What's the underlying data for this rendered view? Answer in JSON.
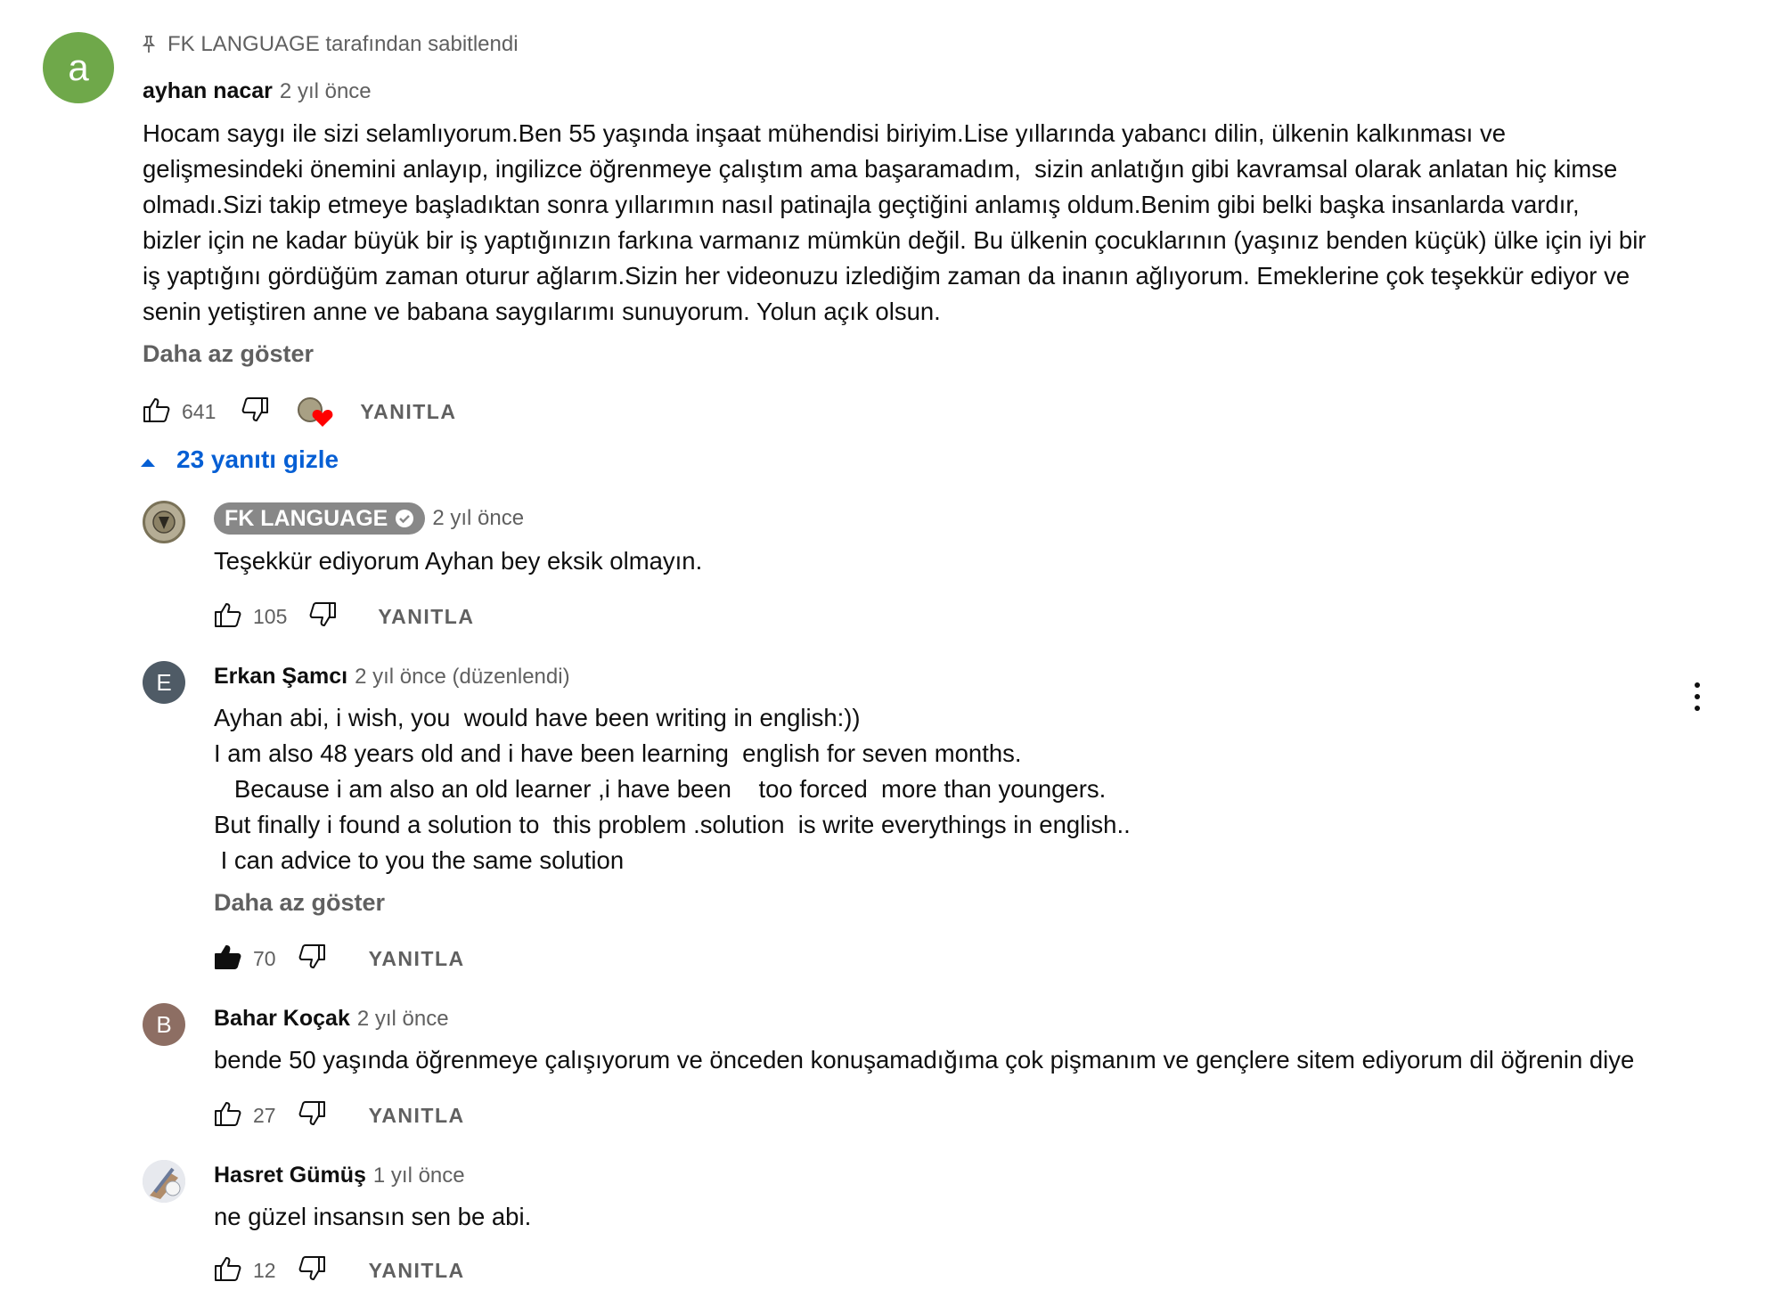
{
  "pinned": {
    "label": "FK LANGUAGE tarafından sabitlendi",
    "avatar_letter": "a",
    "avatar_color": "#6fa84a",
    "author": "ayhan nacar",
    "time": "2 yıl önce",
    "text": "Hocam saygı ile sizi selamlıyorum.Ben 55 yaşında inşaat mühendisi biriyim.Lise yıllarında yabancı dilin, ülkenin kalkınması ve\ngelişmesindeki önemini anlayıp, ingilizce öğrenmeye çalıştım ama başaramadım,  sizin anlatığın gibi kavramsal olarak anlatan hiç kimse\nolmadı.Sizi takip etmeye başladıktan sonra yıllarımın nasıl patinajla geçtiğini anlamış oldum.Benim gibi belki başka insanlarda vardır,\nbizler için ne kadar büyük bir iş yaptığınızın farkına varmanız mümkün değil. Bu ülkenin çocuklarının (yaşınız benden küçük) ülke için iyi bir\niş yaptığını gördüğüm zaman oturur ağlarım.Sizin her videonuzu izlediğim zaman da inanın ağlıyorum. Emeklerine çok teşekkür ediyor ve\nsenin yetiştiren anne ve babana saygılarımı sunuyorum. Yolun açık olsun.",
    "show_less": "Daha az göster",
    "likes": "641",
    "reply": "YANITLA"
  },
  "replies_toggle": "23 yanıtı gizle",
  "replies": [
    {
      "author": "FK LANGUAGE",
      "time": "2 yıl önce",
      "text": "Teşekkür ediyorum Ayhan bey eksik olmayın.",
      "likes": "105",
      "reply": "YANITLA"
    },
    {
      "author": "Erkan Şamcı",
      "avatar_letter": "E",
      "avatar_color": "#4f5b66",
      "time": "2 yıl önce (düzenlendi)",
      "text": "Ayhan abi, i wish, you  would have been writing in english:))\nI am also 48 years old and i have been learning  english for seven months.\n   Because i am also an old learner ,i have been    too forced  more than youngers.\nBut finally i found a solution to  this problem .solution  is write everythings in english..\n I can advice to you the same solution",
      "show_less": "Daha az göster",
      "likes": "70",
      "reply": "YANITLA"
    },
    {
      "author": "Bahar Koçak",
      "avatar_letter": "B",
      "avatar_color": "#8d6e63",
      "time": "2 yıl önce",
      "text": "bende 50 yaşında öğrenmeye çalışıyorum ve önceden konuşamadığıma çok pişmanım ve gençlere sitem ediyorum dil öğrenin diye",
      "likes": "27",
      "reply": "YANITLA"
    },
    {
      "author": "Hasret Gümüş",
      "time": "1 yıl önce",
      "text": "ne güzel insansın sen be abi.",
      "likes": "12",
      "reply": "YANITLA"
    }
  ],
  "icons": {
    "pin": "pin-icon",
    "like": "thumb-up-icon",
    "dislike": "thumb-down-icon",
    "heart": "creator-heart-icon",
    "verified": "verified-check-icon",
    "more": "more-vert-icon",
    "caret": "caret-up-icon"
  }
}
